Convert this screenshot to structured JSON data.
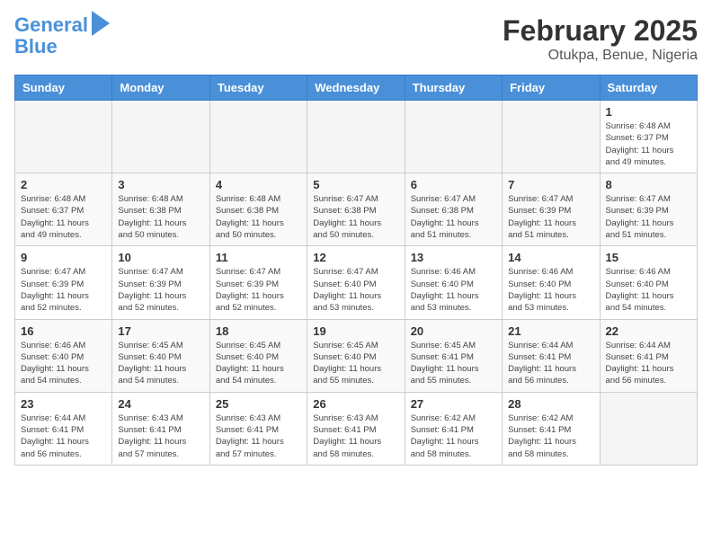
{
  "logo": {
    "line1": "General",
    "line2": "Blue"
  },
  "title": "February 2025",
  "location": "Otukpa, Benue, Nigeria",
  "weekdays": [
    "Sunday",
    "Monday",
    "Tuesday",
    "Wednesday",
    "Thursday",
    "Friday",
    "Saturday"
  ],
  "weeks": [
    [
      {
        "day": "",
        "info": ""
      },
      {
        "day": "",
        "info": ""
      },
      {
        "day": "",
        "info": ""
      },
      {
        "day": "",
        "info": ""
      },
      {
        "day": "",
        "info": ""
      },
      {
        "day": "",
        "info": ""
      },
      {
        "day": "1",
        "info": "Sunrise: 6:48 AM\nSunset: 6:37 PM\nDaylight: 11 hours\nand 49 minutes."
      }
    ],
    [
      {
        "day": "2",
        "info": "Sunrise: 6:48 AM\nSunset: 6:37 PM\nDaylight: 11 hours\nand 49 minutes."
      },
      {
        "day": "3",
        "info": "Sunrise: 6:48 AM\nSunset: 6:38 PM\nDaylight: 11 hours\nand 50 minutes."
      },
      {
        "day": "4",
        "info": "Sunrise: 6:48 AM\nSunset: 6:38 PM\nDaylight: 11 hours\nand 50 minutes."
      },
      {
        "day": "5",
        "info": "Sunrise: 6:47 AM\nSunset: 6:38 PM\nDaylight: 11 hours\nand 50 minutes."
      },
      {
        "day": "6",
        "info": "Sunrise: 6:47 AM\nSunset: 6:38 PM\nDaylight: 11 hours\nand 51 minutes."
      },
      {
        "day": "7",
        "info": "Sunrise: 6:47 AM\nSunset: 6:39 PM\nDaylight: 11 hours\nand 51 minutes."
      },
      {
        "day": "8",
        "info": "Sunrise: 6:47 AM\nSunset: 6:39 PM\nDaylight: 11 hours\nand 51 minutes."
      }
    ],
    [
      {
        "day": "9",
        "info": "Sunrise: 6:47 AM\nSunset: 6:39 PM\nDaylight: 11 hours\nand 52 minutes."
      },
      {
        "day": "10",
        "info": "Sunrise: 6:47 AM\nSunset: 6:39 PM\nDaylight: 11 hours\nand 52 minutes."
      },
      {
        "day": "11",
        "info": "Sunrise: 6:47 AM\nSunset: 6:39 PM\nDaylight: 11 hours\nand 52 minutes."
      },
      {
        "day": "12",
        "info": "Sunrise: 6:47 AM\nSunset: 6:40 PM\nDaylight: 11 hours\nand 53 minutes."
      },
      {
        "day": "13",
        "info": "Sunrise: 6:46 AM\nSunset: 6:40 PM\nDaylight: 11 hours\nand 53 minutes."
      },
      {
        "day": "14",
        "info": "Sunrise: 6:46 AM\nSunset: 6:40 PM\nDaylight: 11 hours\nand 53 minutes."
      },
      {
        "day": "15",
        "info": "Sunrise: 6:46 AM\nSunset: 6:40 PM\nDaylight: 11 hours\nand 54 minutes."
      }
    ],
    [
      {
        "day": "16",
        "info": "Sunrise: 6:46 AM\nSunset: 6:40 PM\nDaylight: 11 hours\nand 54 minutes."
      },
      {
        "day": "17",
        "info": "Sunrise: 6:45 AM\nSunset: 6:40 PM\nDaylight: 11 hours\nand 54 minutes."
      },
      {
        "day": "18",
        "info": "Sunrise: 6:45 AM\nSunset: 6:40 PM\nDaylight: 11 hours\nand 54 minutes."
      },
      {
        "day": "19",
        "info": "Sunrise: 6:45 AM\nSunset: 6:40 PM\nDaylight: 11 hours\nand 55 minutes."
      },
      {
        "day": "20",
        "info": "Sunrise: 6:45 AM\nSunset: 6:41 PM\nDaylight: 11 hours\nand 55 minutes."
      },
      {
        "day": "21",
        "info": "Sunrise: 6:44 AM\nSunset: 6:41 PM\nDaylight: 11 hours\nand 56 minutes."
      },
      {
        "day": "22",
        "info": "Sunrise: 6:44 AM\nSunset: 6:41 PM\nDaylight: 11 hours\nand 56 minutes."
      }
    ],
    [
      {
        "day": "23",
        "info": "Sunrise: 6:44 AM\nSunset: 6:41 PM\nDaylight: 11 hours\nand 56 minutes."
      },
      {
        "day": "24",
        "info": "Sunrise: 6:43 AM\nSunset: 6:41 PM\nDaylight: 11 hours\nand 57 minutes."
      },
      {
        "day": "25",
        "info": "Sunrise: 6:43 AM\nSunset: 6:41 PM\nDaylight: 11 hours\nand 57 minutes."
      },
      {
        "day": "26",
        "info": "Sunrise: 6:43 AM\nSunset: 6:41 PM\nDaylight: 11 hours\nand 58 minutes."
      },
      {
        "day": "27",
        "info": "Sunrise: 6:42 AM\nSunset: 6:41 PM\nDaylight: 11 hours\nand 58 minutes."
      },
      {
        "day": "28",
        "info": "Sunrise: 6:42 AM\nSunset: 6:41 PM\nDaylight: 11 hours\nand 58 minutes."
      },
      {
        "day": "",
        "info": ""
      }
    ]
  ]
}
